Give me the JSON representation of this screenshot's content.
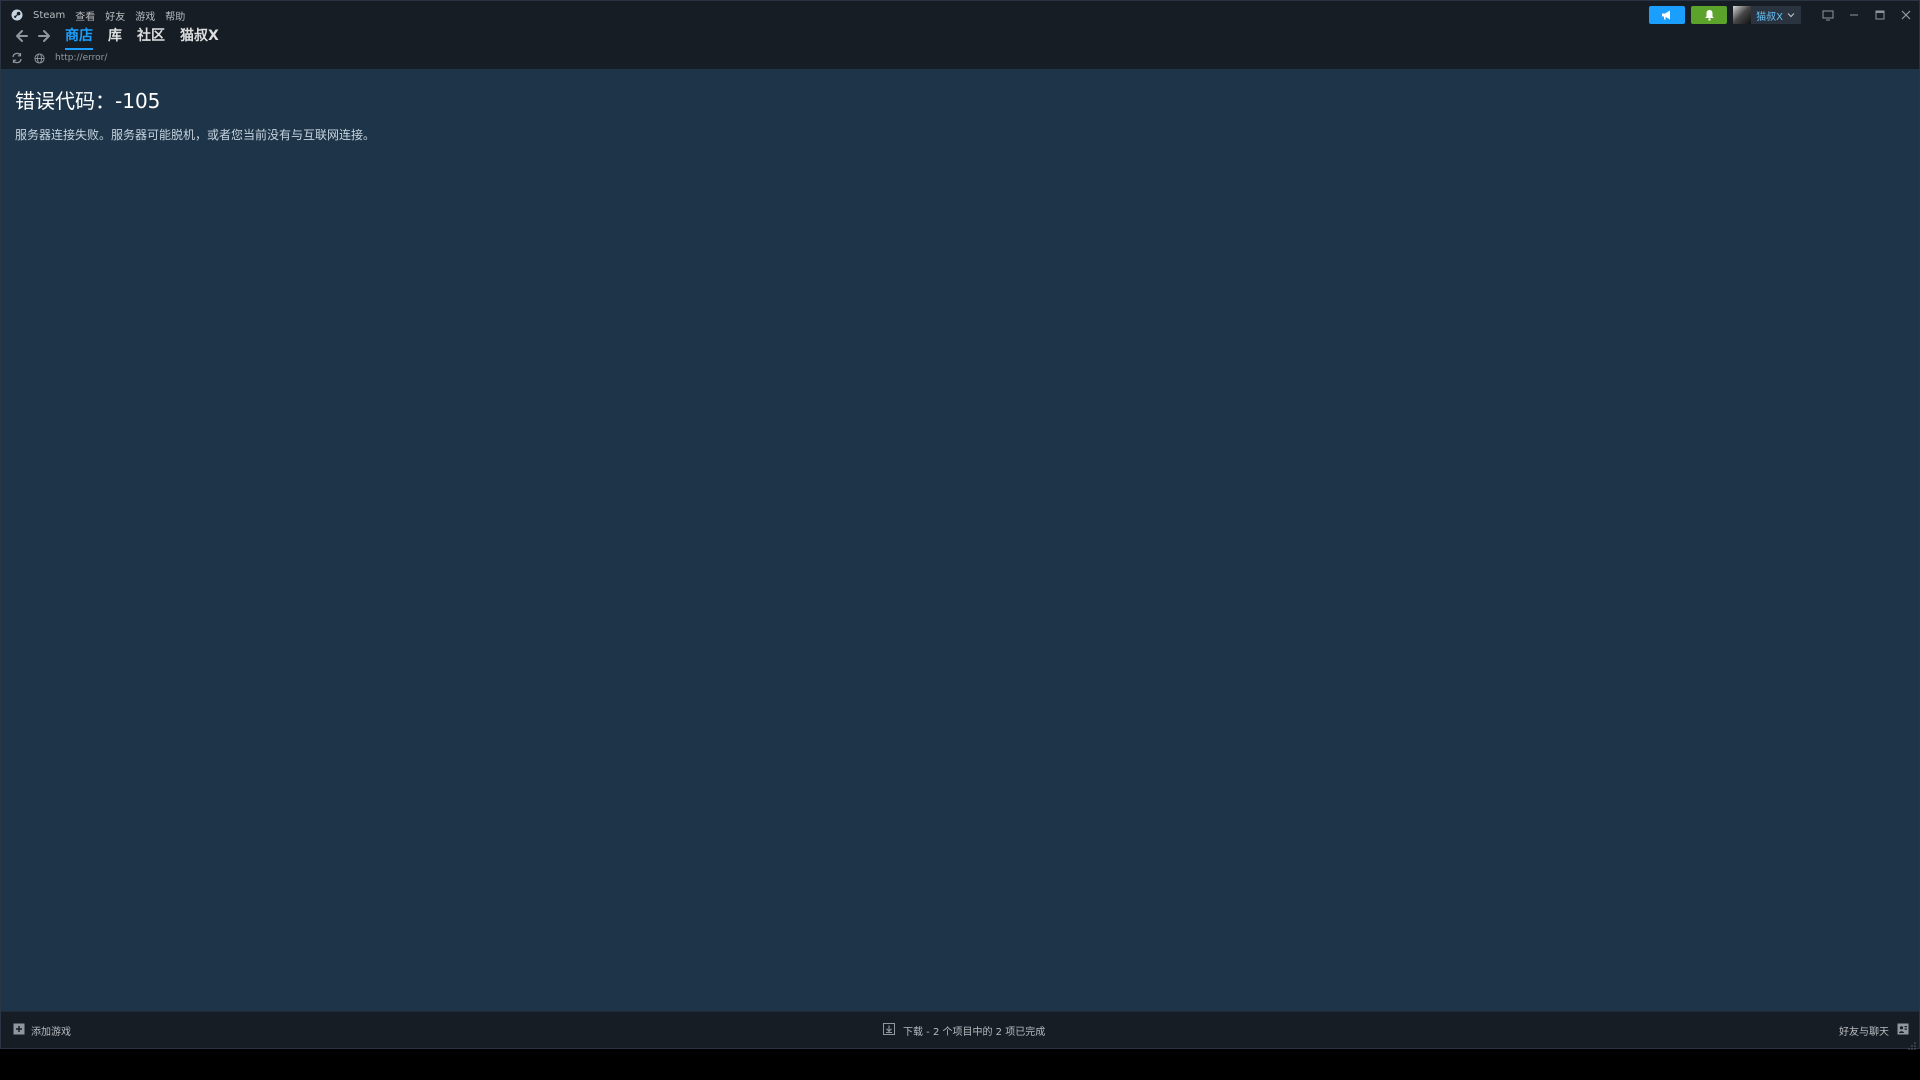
{
  "menu": {
    "app_name": "Steam",
    "items": [
      "查看",
      "好友",
      "游戏",
      "帮助"
    ]
  },
  "nav": {
    "tabs": [
      "商店",
      "库",
      "社区",
      "猫叔X"
    ],
    "active_tab": "商店"
  },
  "url_bar": {
    "url": "http://error/"
  },
  "user": {
    "name": "猫叔X"
  },
  "error": {
    "title": "错误代码：-105",
    "message": "服务器连接失败。服务器可能脱机，或者您当前没有与互联网连接。"
  },
  "bottom": {
    "add_game_label": "添加游戏",
    "downloads_label": "下载 - 2 个项目中的 2 项已完成",
    "friends_chat_label": "好友与聊天"
  },
  "colors": {
    "accent": "#1a9fff",
    "notify_green": "#5ba32b",
    "content_bg": "#1e3549",
    "chrome_bg": "#171d25"
  },
  "icons": {
    "steam": "steam-logo-icon",
    "back": "arrow-left-icon",
    "forward": "arrow-right-icon",
    "reload": "reload-icon",
    "globe": "globe-icon",
    "announce": "megaphone-icon",
    "notify": "bell-icon",
    "big_picture": "monitor-icon",
    "minimize": "minimize-icon",
    "maximize": "maximize-icon",
    "close": "close-icon",
    "add": "plus-square-icon",
    "download": "download-icon",
    "chat": "chat-icon"
  }
}
